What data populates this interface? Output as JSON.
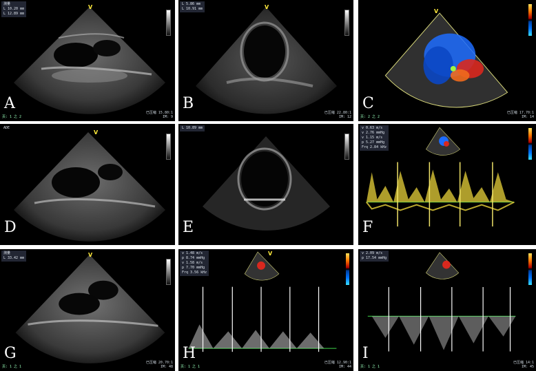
{
  "panels": [
    {
      "letter": "A",
      "hud": [
        "测量",
        "L  10.20 mm",
        "L  12.89 mm"
      ],
      "footer_left": "页: 1 之 2",
      "footer_right": [
        "已压缩 15.80:1",
        "IM: 9"
      ]
    },
    {
      "letter": "B",
      "hud": [
        "L  5.86 mm",
        "L  10.91 mm"
      ],
      "footer_left": "",
      "footer_right": [
        "已压缩 22.80:1",
        "IM: 12"
      ]
    },
    {
      "letter": "C",
      "hud": [],
      "footer_left": "页: 2 之 2",
      "footer_right": [
        "已压缩 17.70:1",
        "IM: 14"
      ]
    },
    {
      "letter": "D",
      "hud": [
        "ADE"
      ],
      "footer_left": "",
      "footer_right": []
    },
    {
      "letter": "E",
      "hud": [
        "L  10.89 mm"
      ],
      "footer_left": "",
      "footer_right": []
    },
    {
      "letter": "F",
      "hud": [
        "v  0.63 m/s",
        "v  2.76 mmHg",
        "v  1.15 m/s",
        "p  5.27 mmHg",
        "Frq  2.84 kHz"
      ],
      "footer_left": "",
      "footer_right": []
    },
    {
      "letter": "G",
      "hud": [
        "测量",
        "L  33.42 mm"
      ],
      "footer_left": "页: 1 之 1",
      "footer_right": [
        "已压缩 20.70:1",
        "IM: 48"
      ]
    },
    {
      "letter": "H",
      "hud": [
        "v  1.48 m/s",
        "p  8.74 mmHg",
        "v  1.58 m/s",
        "p  7.70 mmHg",
        "Frq  3.56 kHz"
      ],
      "footer_left": "页: 1 之 1",
      "footer_right": [
        "已压缩 12.90:1",
        "IM: 44"
      ]
    },
    {
      "letter": "I",
      "hud": [
        "v  2.09 m/s",
        "p  17.54 mmHg"
      ],
      "footer_left": "页: 1 之 1",
      "footer_right": [
        "已压缩 14:1",
        "IM: 45"
      ]
    }
  ],
  "probe_marker": "V",
  "colors": {
    "doppler_trace": "#e8d23a",
    "baseline": "#3fd64a",
    "red_flow": "#d9281e",
    "blue_flow": "#1d6cff"
  }
}
